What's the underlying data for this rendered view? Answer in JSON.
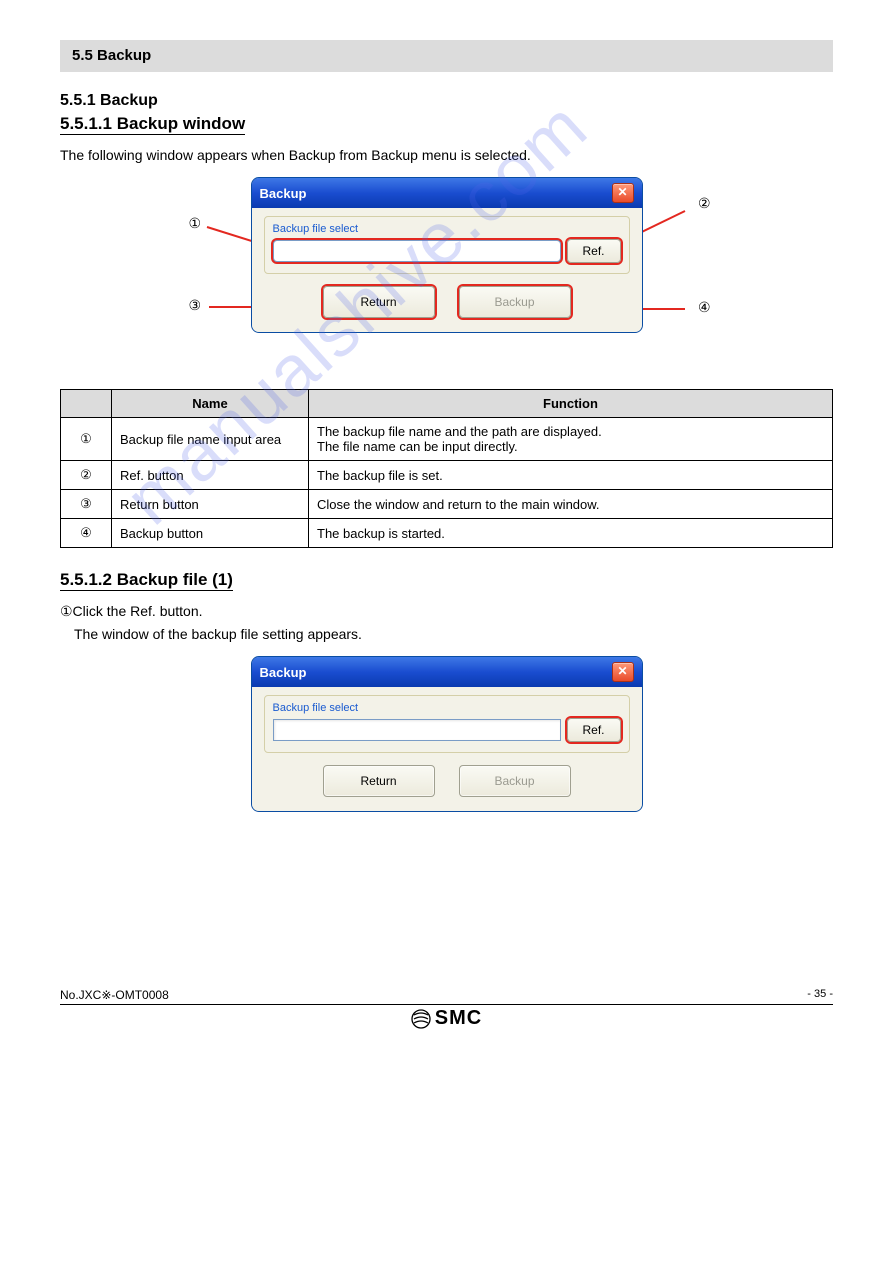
{
  "header": {
    "section_number": "5.5 Backup"
  },
  "titles": {
    "main": "5.5.1 Backup",
    "underlined": "5.5.1.1 Backup window",
    "backup_file": "5.5.1.2 Backup file (1)"
  },
  "paras": {
    "intro": "The following window appears when Backup from Backup menu is selected.",
    "backup_file_step1": "①Click the Ref. button.",
    "backup_file_step2": "The window of the backup file setting appears."
  },
  "dialog": {
    "title": "Backup",
    "fieldset_label": "Backup file select",
    "file_value": "",
    "ref_label": "Ref.",
    "return_label": "Return",
    "backup_label": "Backup",
    "close_glyph": "✕"
  },
  "callouts": {
    "c1": "①",
    "c2": "②",
    "c3": "③",
    "c4": "④"
  },
  "table": {
    "head": [
      "",
      "Name",
      "Function"
    ],
    "rows": [
      [
        "①",
        "Backup file name input area",
        "The backup file name and the path are displayed.\nThe file name can be input directly."
      ],
      [
        "②",
        "Ref. button",
        "The backup file is set."
      ],
      [
        "③",
        "Return button",
        "Close the window and return to the main window."
      ],
      [
        "④",
        "Backup button",
        "The backup is started."
      ]
    ]
  },
  "footer": {
    "left": "No.JXC※-OMT0008",
    "pg_prefix": "- ",
    "pg_num": "35",
    "pg_suffix": " -",
    "logo_text": "SMC"
  },
  "watermark": "manualshive.com"
}
